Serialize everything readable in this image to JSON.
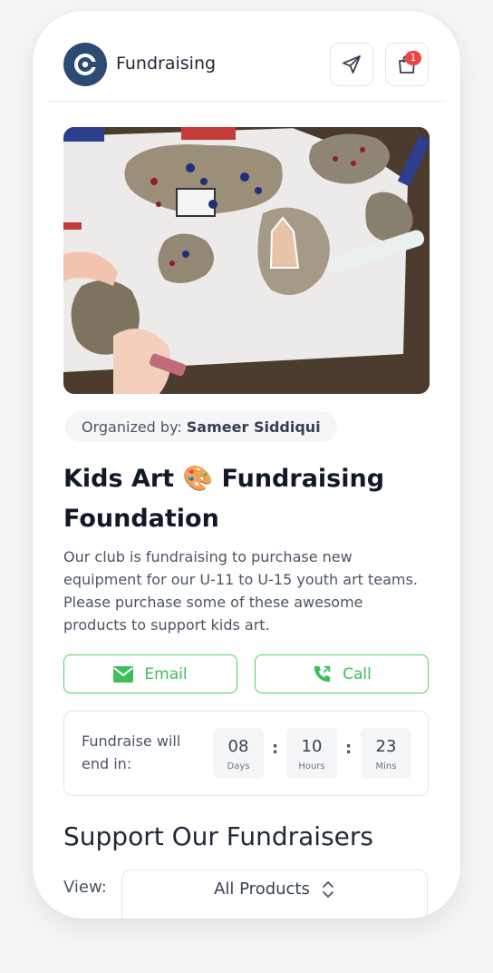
{
  "header": {
    "title": "Fundraising",
    "logo_icon": "logo-c-icon",
    "send_icon": "send-icon",
    "cart_icon": "shopping-bag-icon",
    "cart_badge": "1"
  },
  "hero": {
    "image_desc_icon": "kids-painting-rocks-photo"
  },
  "organizer": {
    "label": "Organized by:",
    "name": "Sameer Siddiqui"
  },
  "fundraiser": {
    "title": "Kids Art 🎨 Fundraising Foundation",
    "description": "Our club is fundraising to purchase new equipment for our U-11 to U-15 youth art teams. Please purchase some of these awesome products to support kids art."
  },
  "actions": {
    "email_label": "Email",
    "call_label": "Call"
  },
  "countdown": {
    "label": "Fundraise will end in:",
    "units": [
      {
        "value": "08",
        "caption": "Days"
      },
      {
        "value": "10",
        "caption": "Hours"
      },
      {
        "value": "23",
        "caption": "Mins"
      }
    ],
    "separator": ":"
  },
  "support": {
    "title": "Support Our Fundraisers",
    "view_label": "View:",
    "view_selected": "All Products"
  },
  "colors": {
    "brand": "#2c4a73",
    "accent_green": "#3fbf5c",
    "badge_red": "#ef4444"
  }
}
